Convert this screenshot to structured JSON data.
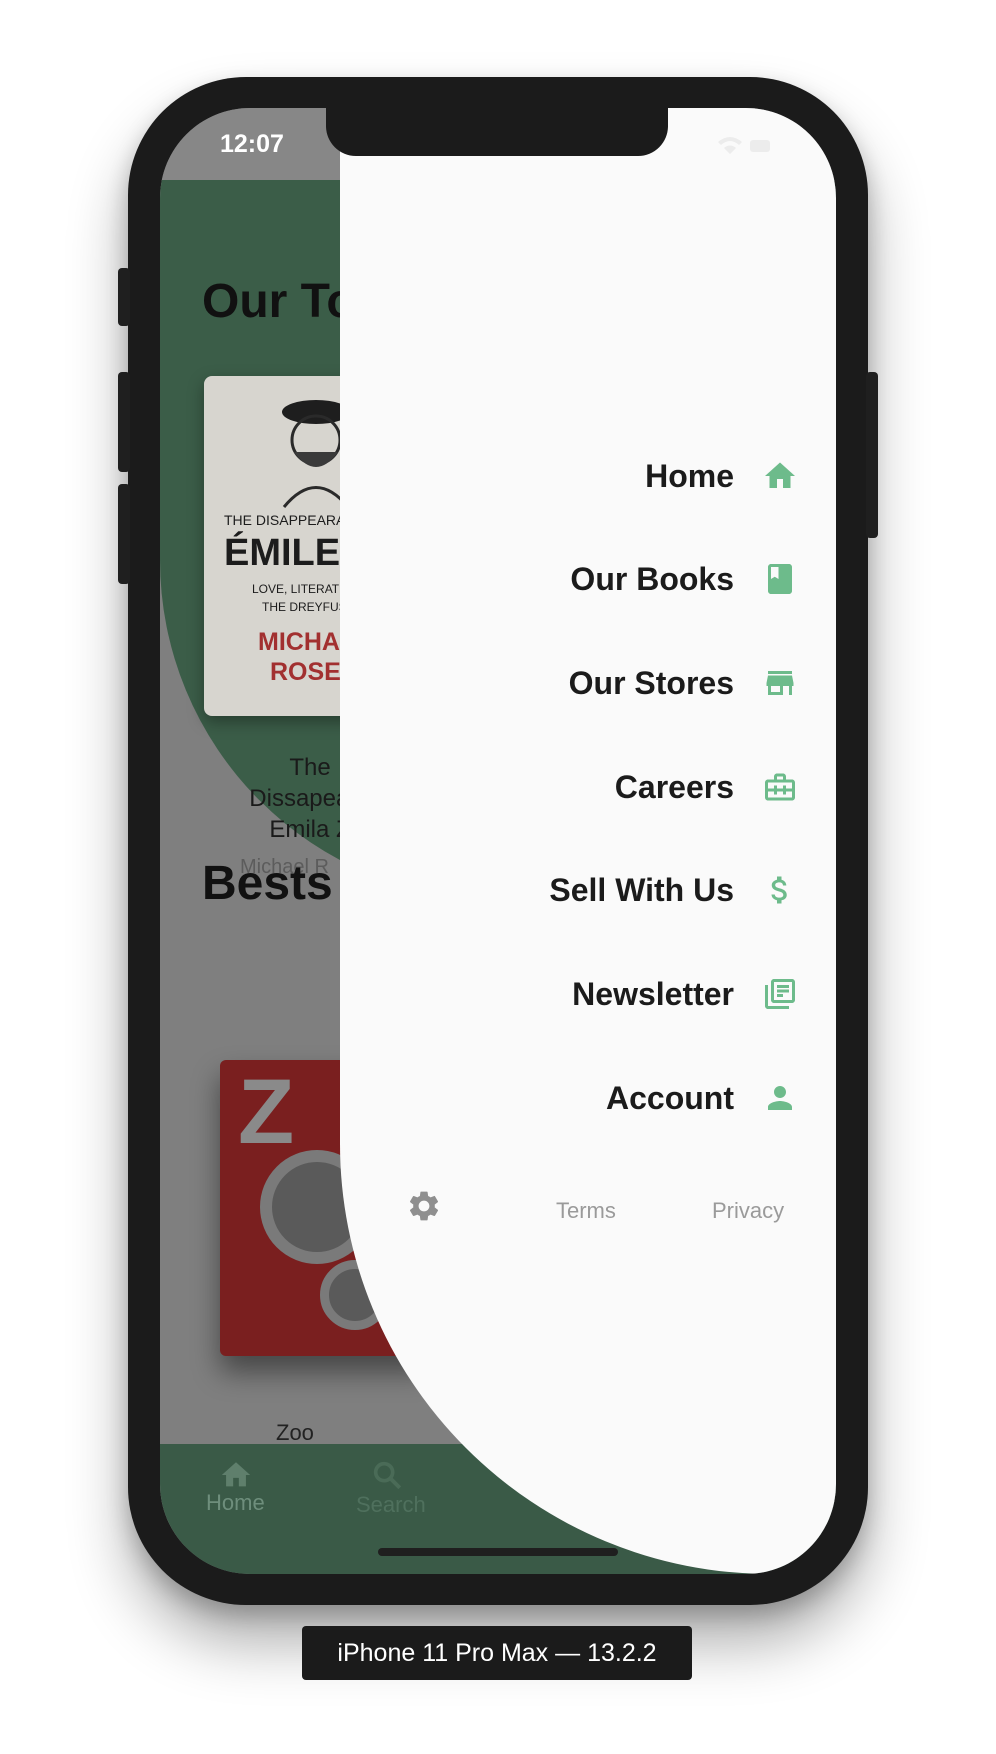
{
  "status_bar": {
    "time": "12:07"
  },
  "background_app": {
    "section_top": "Our To",
    "book1_cover": {
      "line1": "THE DISAPPEARA",
      "line2": "ÉMILE Z",
      "line3": "LOVE, LITERATU",
      "line4": "THE DREYFUS C",
      "line5": "MICHA",
      "line6": "ROSE"
    },
    "book1_caption": [
      "The",
      "Dissapeara",
      "Emila Z"
    ],
    "book1_author": "Michael R",
    "section_bestsellers": "Bests",
    "book2_caption": "Zoo",
    "tabs": [
      {
        "label": "Home",
        "icon": "home-icon"
      },
      {
        "label": "Search",
        "icon": "search-icon"
      }
    ]
  },
  "drawer": {
    "accent_color": "#6dbb8b",
    "menu": [
      {
        "label": "Home",
        "icon": "home-icon"
      },
      {
        "label": "Our Books",
        "icon": "book-icon"
      },
      {
        "label": "Our Stores",
        "icon": "store-icon"
      },
      {
        "label": "Careers",
        "icon": "briefcase-icon"
      },
      {
        "label": "Sell With Us",
        "icon": "dollar-icon"
      },
      {
        "label": "Newsletter",
        "icon": "newsletter-icon"
      },
      {
        "label": "Account",
        "icon": "person-icon"
      }
    ],
    "footer": {
      "settings_icon": "gear-icon",
      "terms": "Terms",
      "privacy": "Privacy"
    }
  },
  "device_label": "iPhone 11 Pro Max — 13.2.2"
}
